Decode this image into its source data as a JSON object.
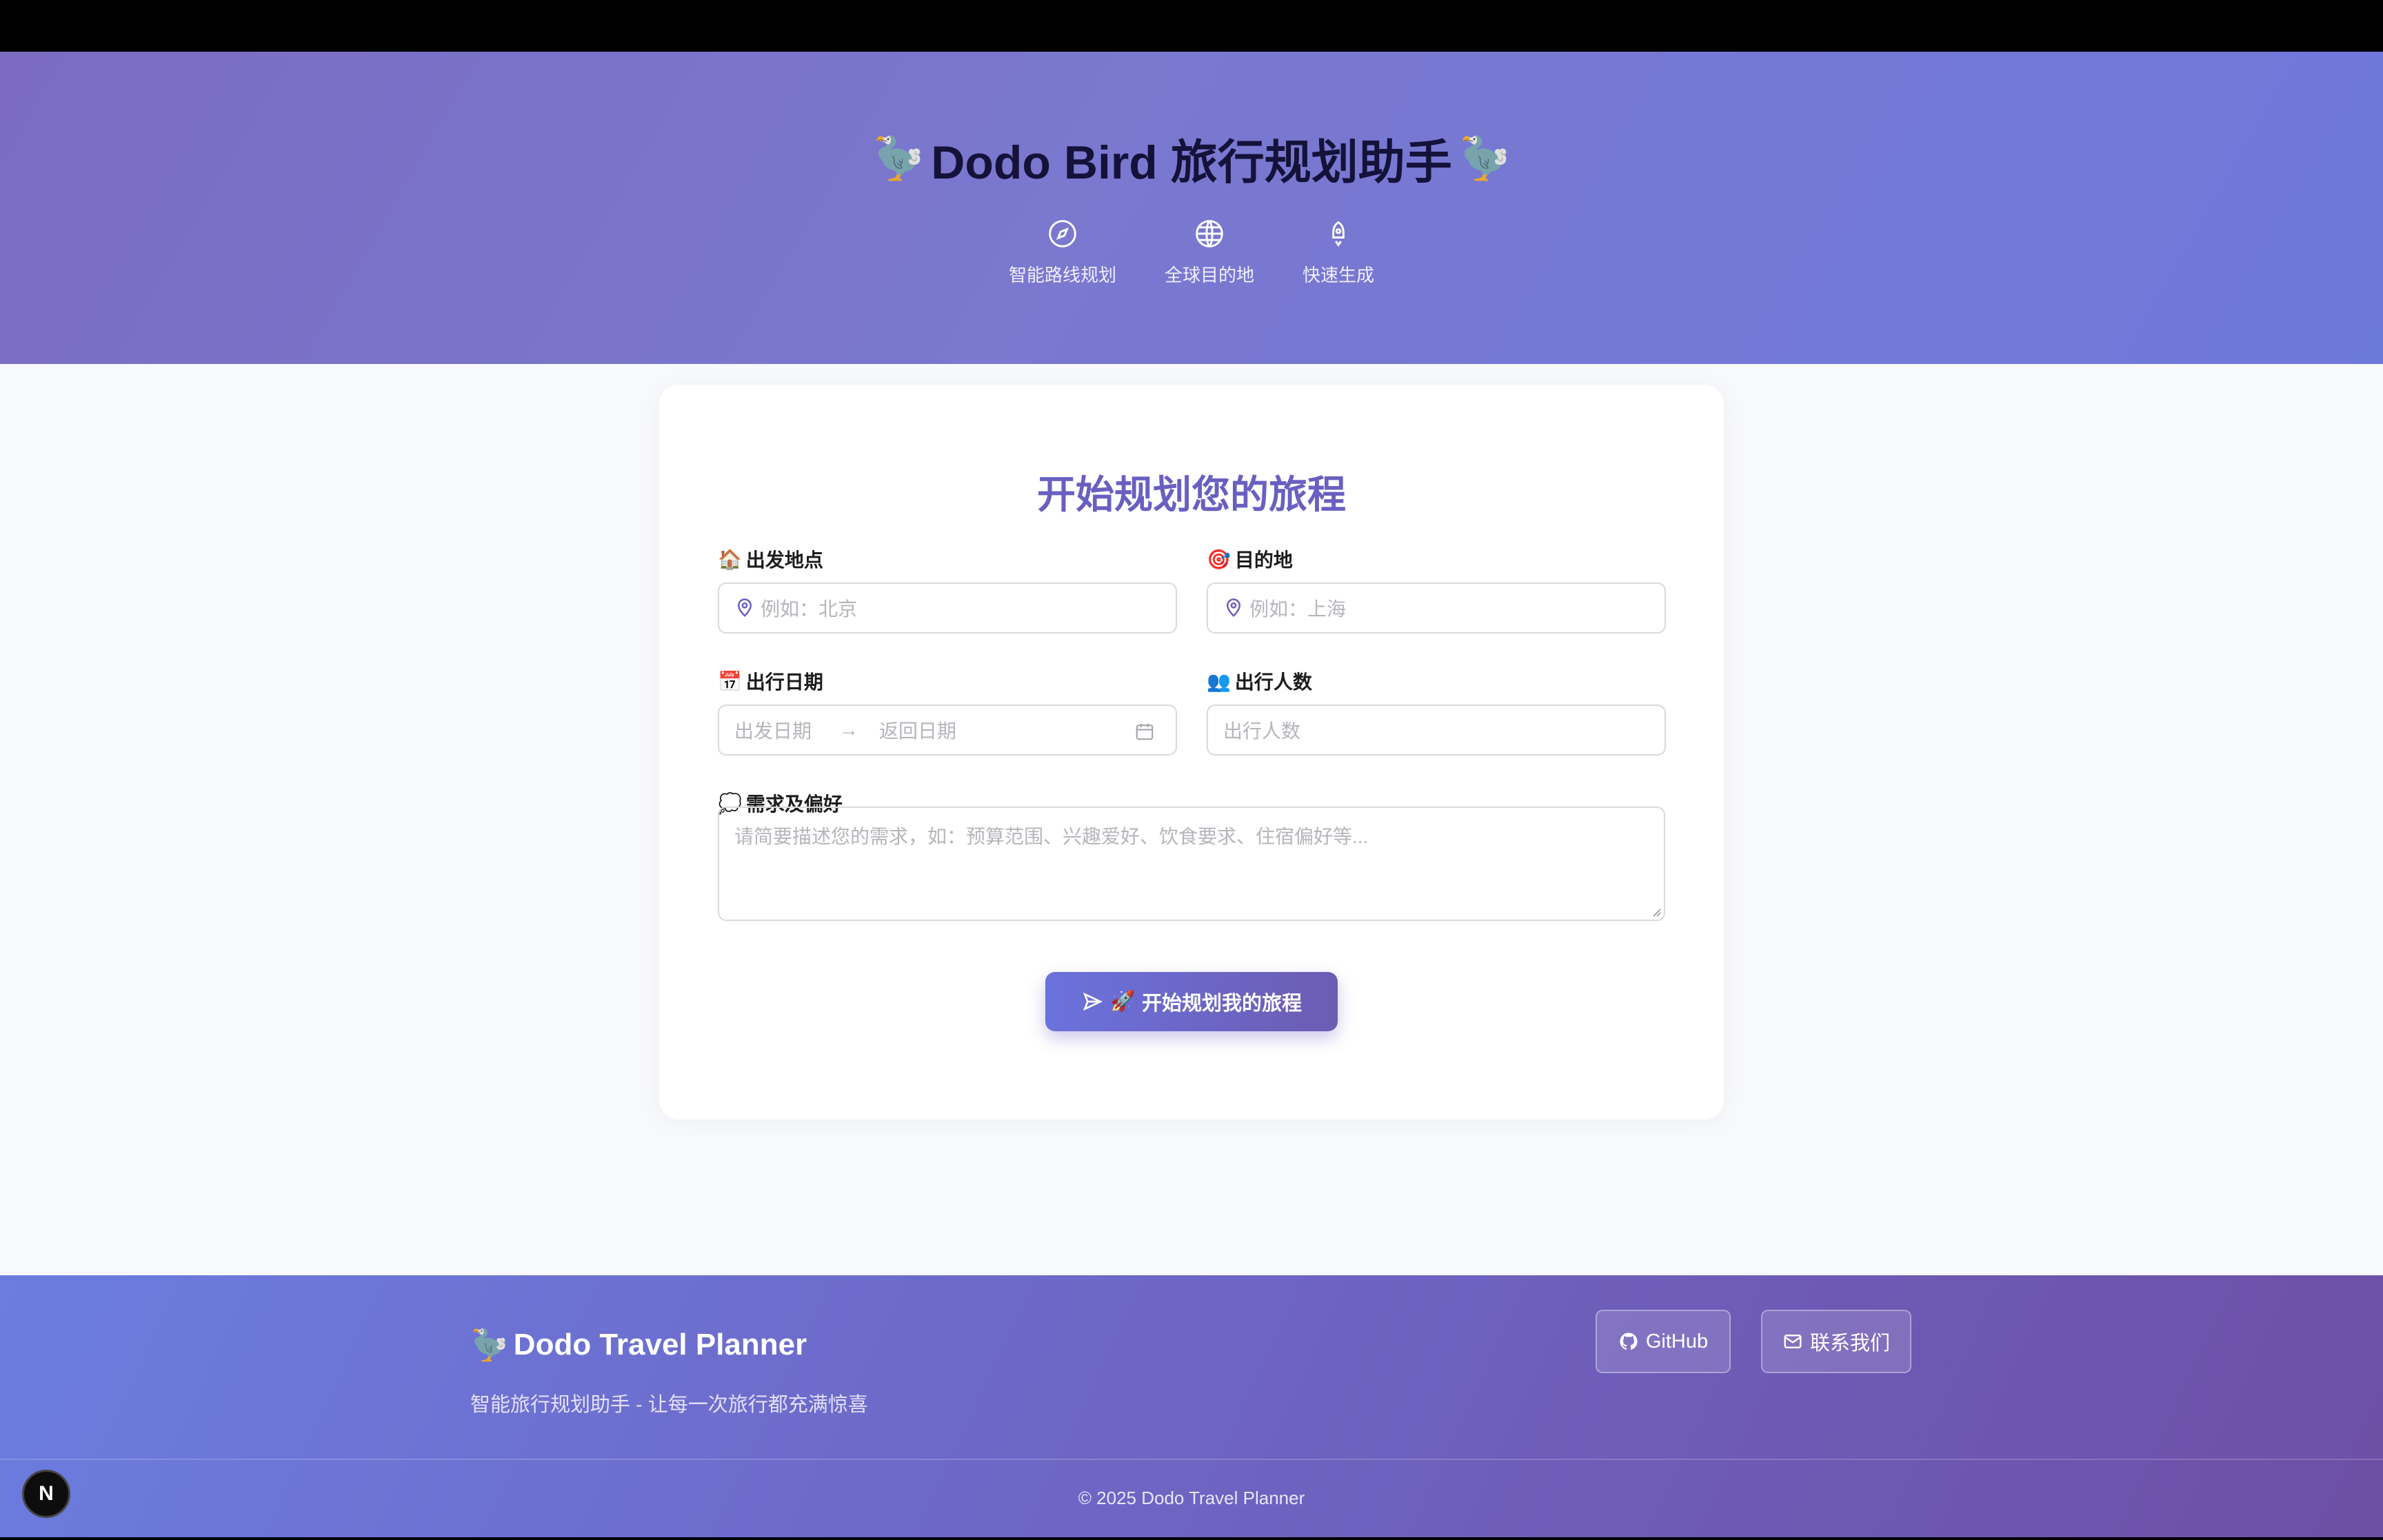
{
  "header": {
    "emoji_left": "🦤",
    "title": "Dodo Bird 旅行规划助手",
    "emoji_right": "🦤",
    "features": [
      {
        "icon": "compass-icon",
        "label": "智能路线规划"
      },
      {
        "icon": "globe-icon",
        "label": "全球目的地"
      },
      {
        "icon": "rocket-icon",
        "label": "快速生成"
      }
    ]
  },
  "form": {
    "title": "开始规划您的旅程",
    "origin": {
      "emoji": "🏠",
      "label": "出发地点",
      "placeholder": "例如：北京"
    },
    "destination": {
      "emoji": "🎯",
      "label": "目的地",
      "placeholder": "例如：上海"
    },
    "dates": {
      "emoji": "📅",
      "label": "出行日期",
      "start_placeholder": "出发日期",
      "separator": "→",
      "end_placeholder": "返回日期"
    },
    "people": {
      "emoji": "👥",
      "label": "出行人数",
      "placeholder": "出行人数"
    },
    "preferences": {
      "emoji": "💭",
      "label": "需求及偏好",
      "placeholder": "请简要描述您的需求，如：预算范围、兴趣爱好、饮食要求、住宿偏好等..."
    },
    "submit": {
      "emoji": "🚀",
      "label": "开始规划我的旅程"
    }
  },
  "footer": {
    "brand_emoji": "🦤",
    "brand": "Dodo Travel Planner",
    "tagline": "智能旅行规划助手 - 让每一次旅行都充满惊喜",
    "github_label": "GitHub",
    "contact_label": "联系我们",
    "copyright": "© 2025 Dodo Travel Planner"
  },
  "dev_badge": "N",
  "colors": {
    "accent": "#6a5fc1",
    "hero_start": "#7b6cc2",
    "hero_end": "#6d78db"
  }
}
